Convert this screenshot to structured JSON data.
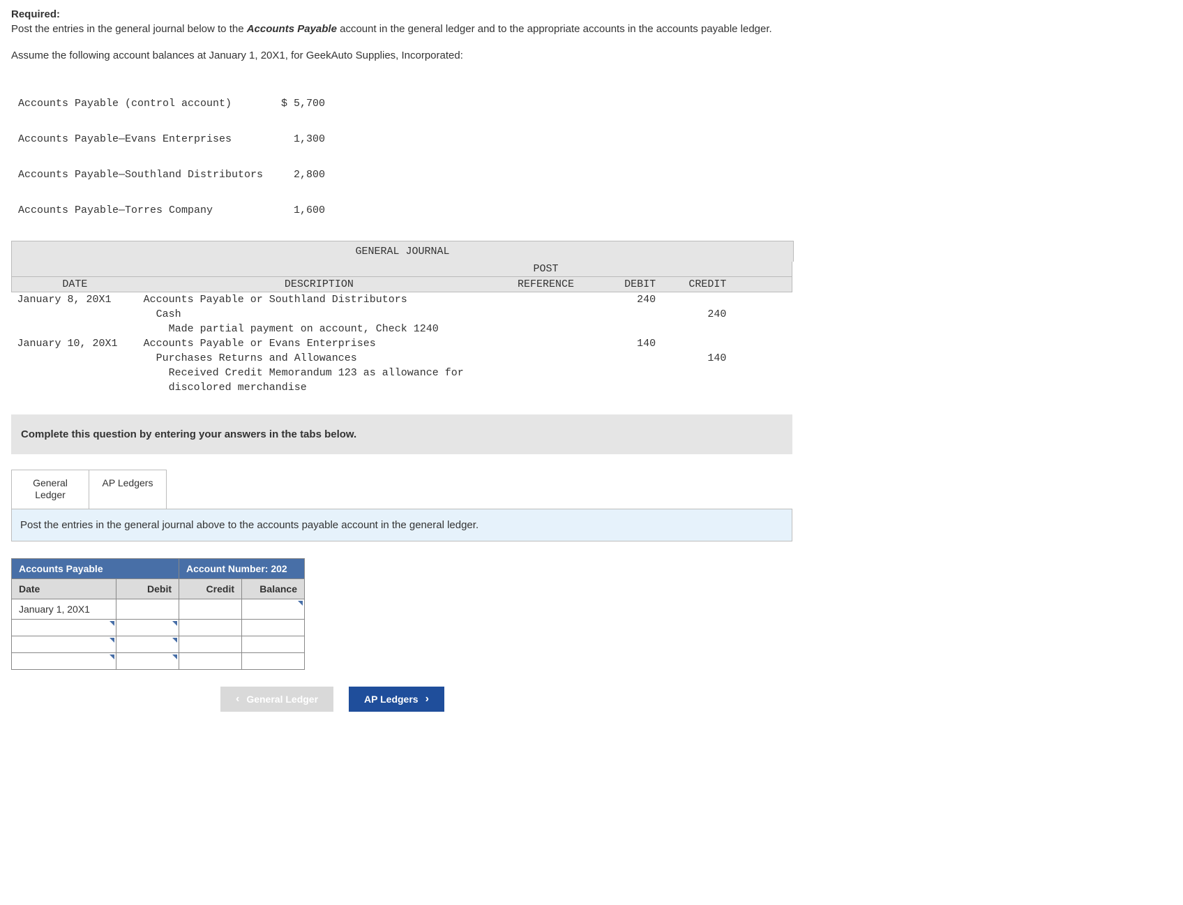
{
  "required_heading": "Required:",
  "intro_pre": "Post the entries in the general journal below to the ",
  "intro_em": "Accounts Payable",
  "intro_post": " account in the general ledger and to the appropriate accounts in the accounts payable ledger.",
  "assume": "Assume the following account balances at January 1, 20X1, for GeekAuto Supplies, Incorporated:",
  "balances": [
    {
      "label": "Accounts Payable (control account)",
      "amount": "$ 5,700"
    },
    {
      "label": "Accounts Payable—Evans Enterprises",
      "amount": "1,300"
    },
    {
      "label": "Accounts Payable—Southland Distributors",
      "amount": "2,800"
    },
    {
      "label": "Accounts Payable—Torres Company",
      "amount": "1,600"
    }
  ],
  "journal": {
    "title": "GENERAL JOURNAL",
    "headers": {
      "date": "DATE",
      "description": "DESCRIPTION",
      "post_top": "POST",
      "post_bottom": "REFERENCE",
      "debit": "DEBIT",
      "credit": "CREDIT"
    },
    "rows": [
      {
        "date": "January 8, 20X1",
        "desc": "Accounts Payable or Southland Distributors",
        "post": "",
        "debit": "240",
        "credit": "",
        "indent": 0
      },
      {
        "date": "",
        "desc": "Cash",
        "post": "",
        "debit": "",
        "credit": "240",
        "indent": 1
      },
      {
        "date": "",
        "desc": "Made partial payment on account, Check 1240",
        "post": "",
        "debit": "",
        "credit": "",
        "indent": 2
      },
      {
        "date": "January 10, 20X1",
        "desc": "Accounts Payable or Evans Enterprises",
        "post": "",
        "debit": "140",
        "credit": "",
        "indent": 0
      },
      {
        "date": "",
        "desc": "Purchases Returns and Allowances",
        "post": "",
        "debit": "",
        "credit": "140",
        "indent": 1
      },
      {
        "date": "",
        "desc": "Received Credit Memorandum 123 as allowance for",
        "post": "",
        "debit": "",
        "credit": "",
        "indent": 2
      },
      {
        "date": "",
        "desc": "discolored merchandise",
        "post": "",
        "debit": "",
        "credit": "",
        "indent": 2
      }
    ]
  },
  "instruction": "Complete this question by entering your answers in the tabs below.",
  "tabs": {
    "tab1_line1": "General",
    "tab1_line2": "Ledger",
    "tab2": "AP Ledgers"
  },
  "tab_msg": "Post the entries in the general journal above to the accounts payable account in the general ledger.",
  "ledger": {
    "title_left": "Accounts Payable",
    "title_right": "Account Number: 202",
    "cols": {
      "date": "Date",
      "debit": "Debit",
      "credit": "Credit",
      "balance": "Balance"
    },
    "row1_date": "January 1, 20X1"
  },
  "nav": {
    "prev": "General Ledger",
    "next": "AP Ledgers"
  }
}
